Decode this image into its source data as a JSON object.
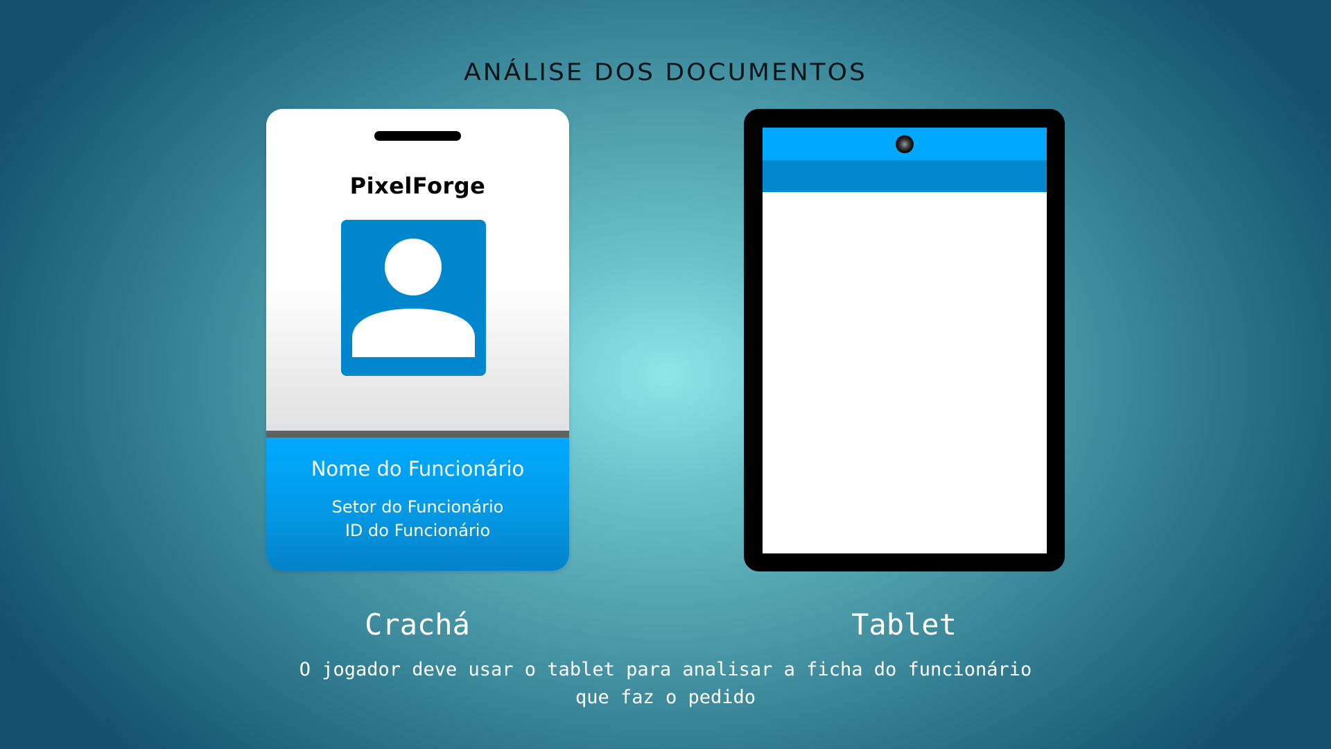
{
  "title": "ANÁLISE DOS DOCUMENTOS",
  "badge": {
    "company": "PixelForge",
    "employee_name": "Nome do Funcionário",
    "employee_sector": "Setor do Funcionário",
    "employee_id": "ID do Funcionário",
    "photo_icon": "user-avatar-icon",
    "caption": "Crachá"
  },
  "tablet": {
    "caption": "Tablet",
    "camera_icon": "camera-icon"
  },
  "description": {
    "line1": "O jogador deve usar o tablet para analisar a ficha do funcionário",
    "line2": "que faz o pedido"
  },
  "colors": {
    "badge_blue": "#00aaff",
    "photo_blue": "#0086cc",
    "tablet_topbar": "#00a8ff",
    "tablet_subbar": "#0088cc"
  }
}
